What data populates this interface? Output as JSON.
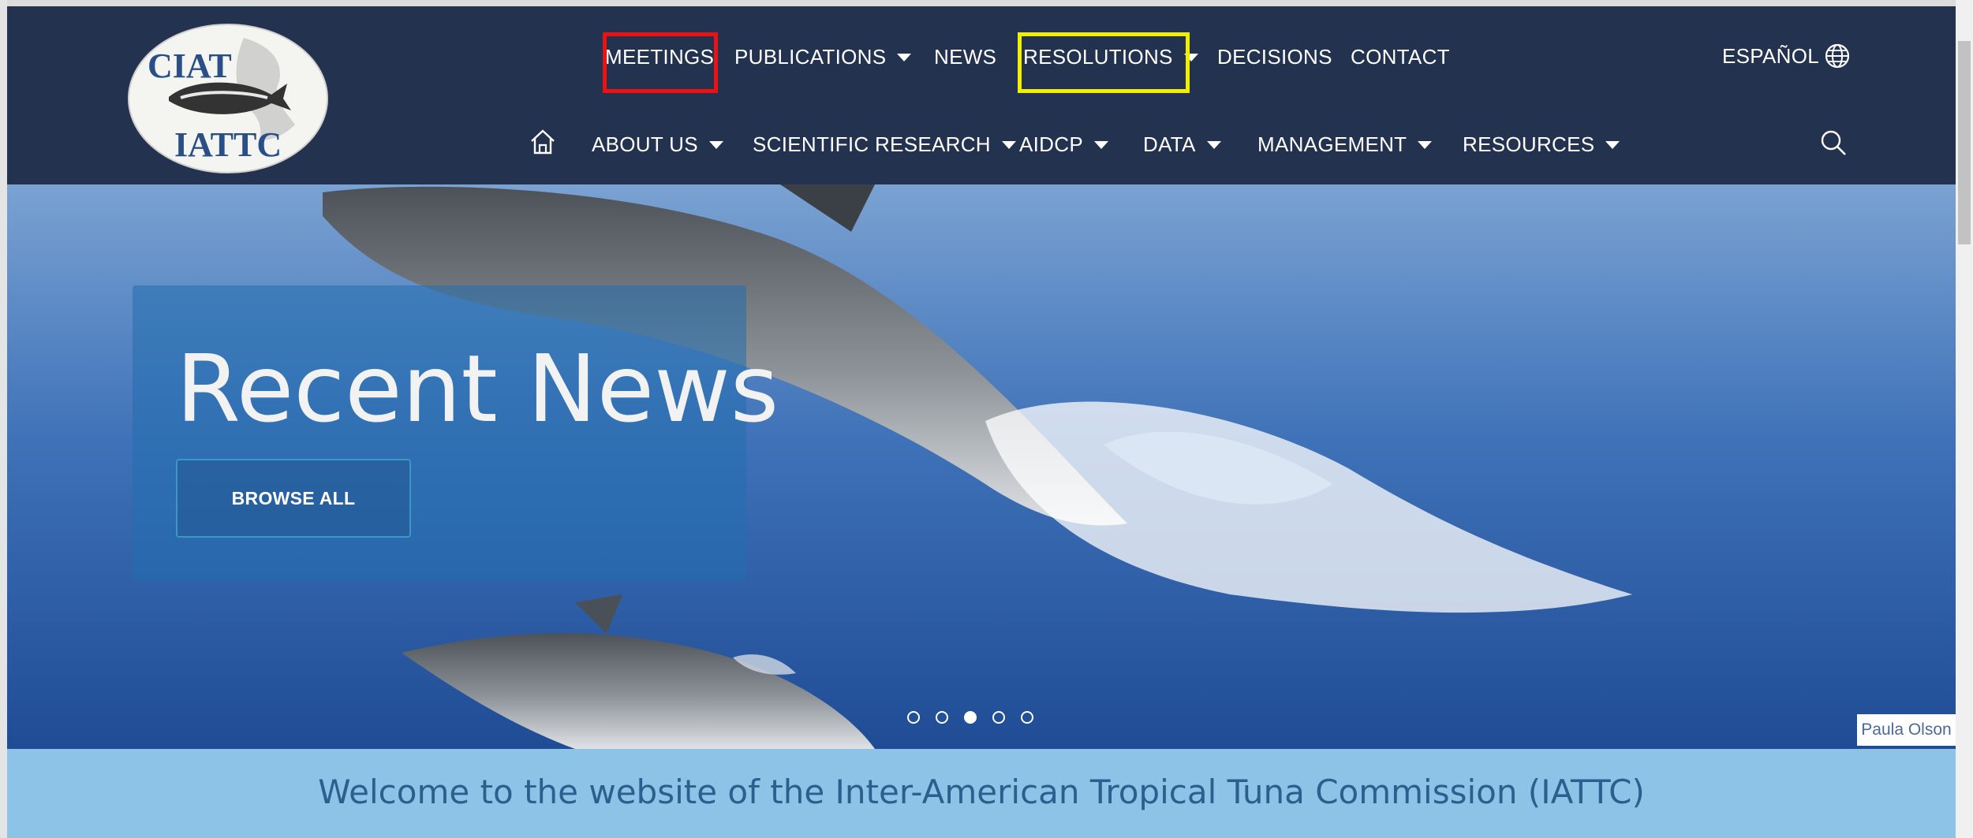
{
  "header": {
    "logo": {
      "top_text": "CIAT",
      "bottom_text": "IATTC"
    },
    "top_nav": [
      {
        "label": "MEETINGS",
        "dropdown": false
      },
      {
        "label": "PUBLICATIONS",
        "dropdown": true
      },
      {
        "label": "NEWS",
        "dropdown": false
      },
      {
        "label": "RESOLUTIONS",
        "dropdown": true
      },
      {
        "label": "DECISIONS",
        "dropdown": false
      },
      {
        "label": "CONTACT",
        "dropdown": false
      }
    ],
    "language": "ESPAÑOL",
    "bottom_nav": [
      {
        "label": "ABOUT US",
        "dropdown": true
      },
      {
        "label": "SCIENTIFIC RESEARCH",
        "dropdown": true
      },
      {
        "label": "AIDCP",
        "dropdown": true
      },
      {
        "label": "DATA",
        "dropdown": true
      },
      {
        "label": "MANAGEMENT",
        "dropdown": true
      },
      {
        "label": "RESOURCES",
        "dropdown": true
      }
    ],
    "icons": {
      "home": "home-icon",
      "search": "search-icon",
      "language": "globe-icon"
    },
    "highlights": {
      "meetings": "#ee1111",
      "resolutions": "#f2ee00"
    },
    "colors": {
      "navy": "#23324f"
    }
  },
  "hero": {
    "title": "Recent News",
    "button": "BROWSE ALL",
    "carousel": {
      "count": 5,
      "active": 3
    },
    "photo_credit": "Paula Olson"
  },
  "welcome": {
    "text": "Welcome to the website of the Inter-American Tropical Tuna Commission (IATTC)",
    "bg_color": "#8ec3e8"
  }
}
